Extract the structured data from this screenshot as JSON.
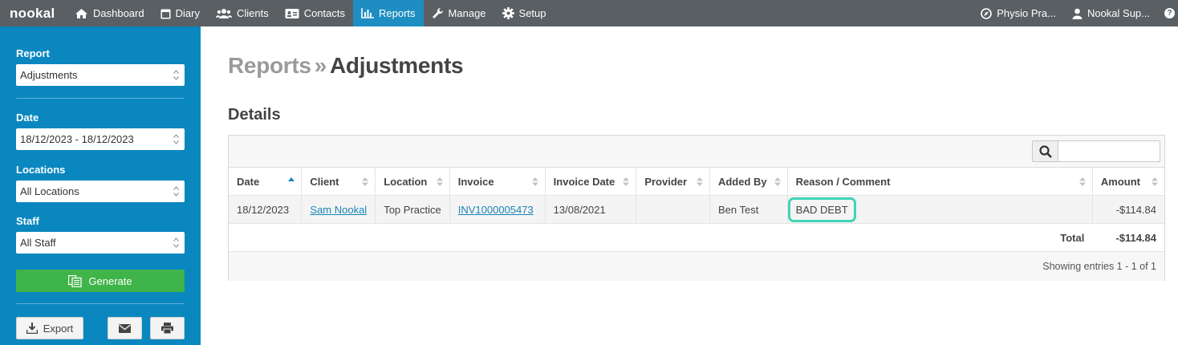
{
  "nav": {
    "logo": "nookal",
    "items": [
      {
        "label": "Dashboard",
        "icon": "home-icon"
      },
      {
        "label": "Diary",
        "icon": "calendar-icon"
      },
      {
        "label": "Clients",
        "icon": "clients-icon"
      },
      {
        "label": "Contacts",
        "icon": "contacts-icon"
      },
      {
        "label": "Reports",
        "icon": "bar-chart-icon",
        "active": true
      },
      {
        "label": "Manage",
        "icon": "wrench-icon"
      },
      {
        "label": "Setup",
        "icon": "gear-icon"
      }
    ],
    "location": "Physio Pra...",
    "user": "Nookal Sup...",
    "help": "?",
    "active_color": "#1e8ec2"
  },
  "sidebar": {
    "report_label": "Report",
    "report_value": "Adjustments",
    "date_label": "Date",
    "date_value": "18/12/2023 - 18/12/2023",
    "locations_label": "Locations",
    "locations_value": "All Locations",
    "staff_label": "Staff",
    "staff_value": "All Staff",
    "generate_label": "Generate",
    "export_label": "Export",
    "bg_color": "#0a87bf",
    "generate_color": "#3fb449"
  },
  "main": {
    "crumb_parent": "Reports",
    "crumb_sep": "»",
    "crumb_current": "Adjustments",
    "section_title": "Details",
    "table": {
      "columns": [
        "Date",
        "Client",
        "Location",
        "Invoice",
        "Invoice Date",
        "Provider",
        "Added By",
        "Reason / Comment",
        "Amount"
      ],
      "rows": [
        {
          "date": "18/12/2023",
          "client": "Sam Nookal",
          "location": "Top Practice",
          "invoice": "INV1000005473",
          "invoice_date": "13/08/2021",
          "provider": "",
          "added_by": "Ben Test",
          "reason": "BAD DEBT",
          "amount": "-$114.84"
        }
      ],
      "total_label": "Total",
      "total_amount": "-$114.84",
      "footer": "Showing entries 1 - 1 of 1"
    }
  }
}
